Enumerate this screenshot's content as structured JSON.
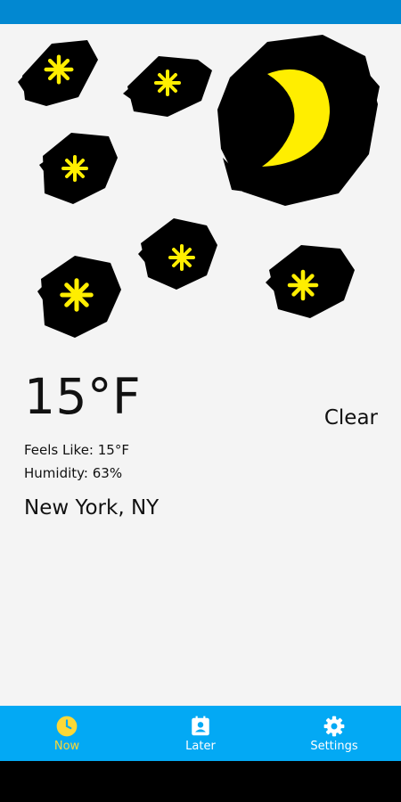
{
  "weather": {
    "temperature": "15°F",
    "condition": "Clear",
    "feels_like": "Feels Like: 15°F",
    "humidity": "Humidity: 63%",
    "location": "New York, NY"
  },
  "illustration": {
    "icons": [
      "moon-icon",
      "star-icon"
    ],
    "colors": {
      "scribble": "#000000",
      "accent": "#ffee00"
    }
  },
  "nav": {
    "items": [
      {
        "label": "Now",
        "icon": "clock-icon",
        "active": true
      },
      {
        "label": "Later",
        "icon": "calendar-contact-icon",
        "active": false
      },
      {
        "label": "Settings",
        "icon": "gear-icon",
        "active": false
      }
    ]
  },
  "colors": {
    "status_bar": "#0288d1",
    "nav_bar": "#03a9f4",
    "active_nav": "#fdd835",
    "background": "#f4f4f4"
  }
}
